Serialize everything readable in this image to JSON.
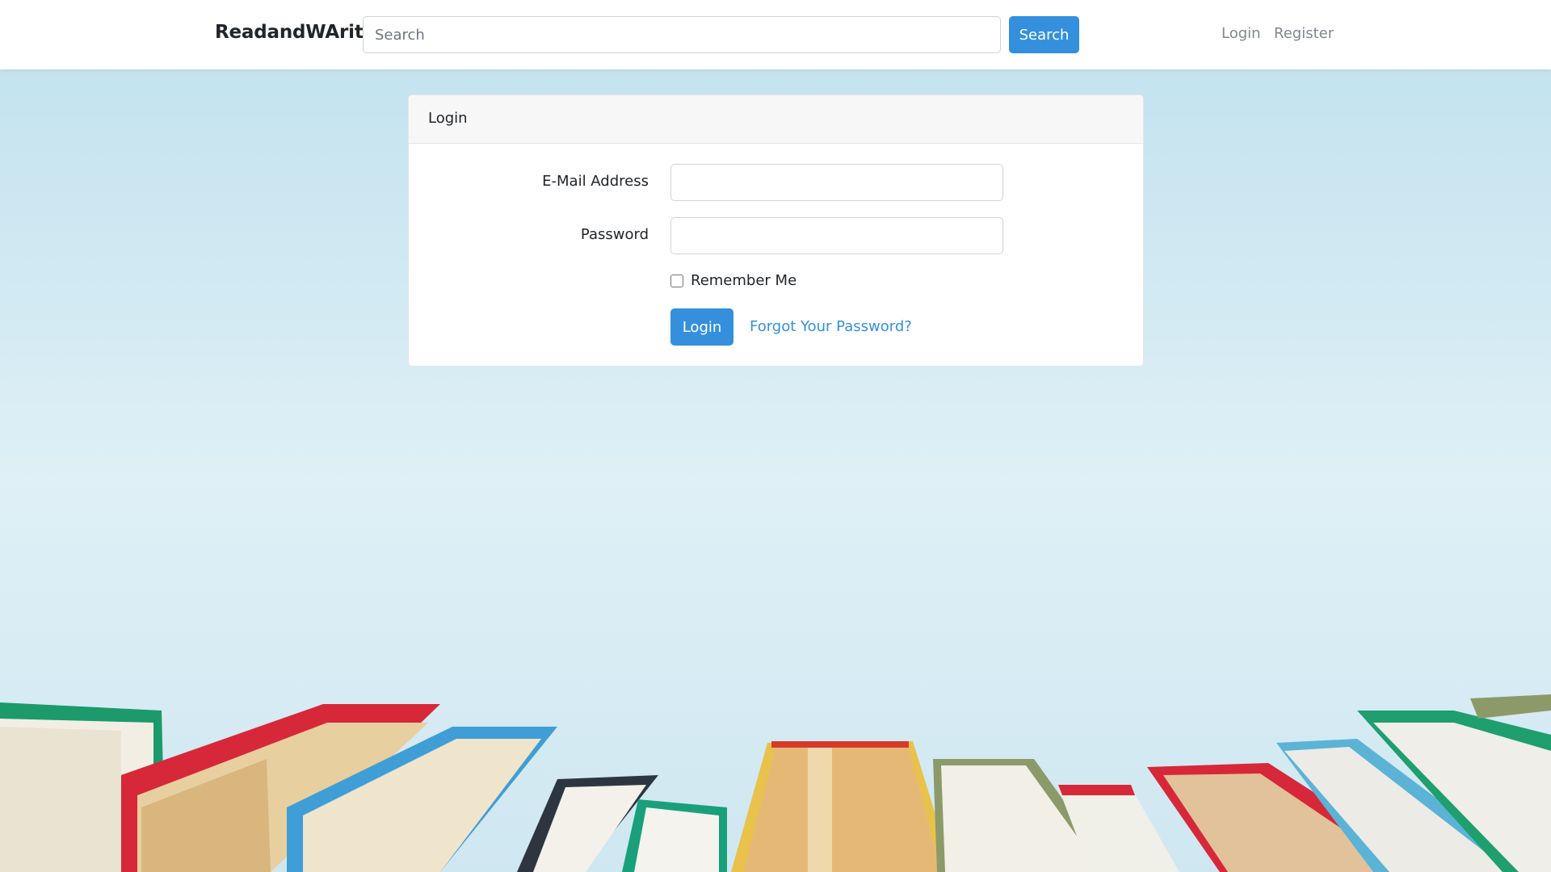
{
  "navbar": {
    "brand": "ReadandWArite",
    "search_placeholder": "Search",
    "search_button": "Search",
    "links": {
      "login": "Login",
      "register": "Register"
    }
  },
  "login_card": {
    "header": "Login",
    "email_label": "E-Mail Address",
    "email_value": "",
    "password_label": "Password",
    "password_value": "",
    "remember_label": "Remember Me",
    "remember_checked": false,
    "submit_label": "Login",
    "forgot_label": "Forgot Your Password?"
  },
  "colors": {
    "primary": "#3490dc",
    "background_sky": "#d7ecf4",
    "book_colors": [
      "#1f9e6e",
      "#d62839",
      "#3f9ed6",
      "#e8c24a",
      "#8c9a6a",
      "#f0efe8"
    ]
  }
}
